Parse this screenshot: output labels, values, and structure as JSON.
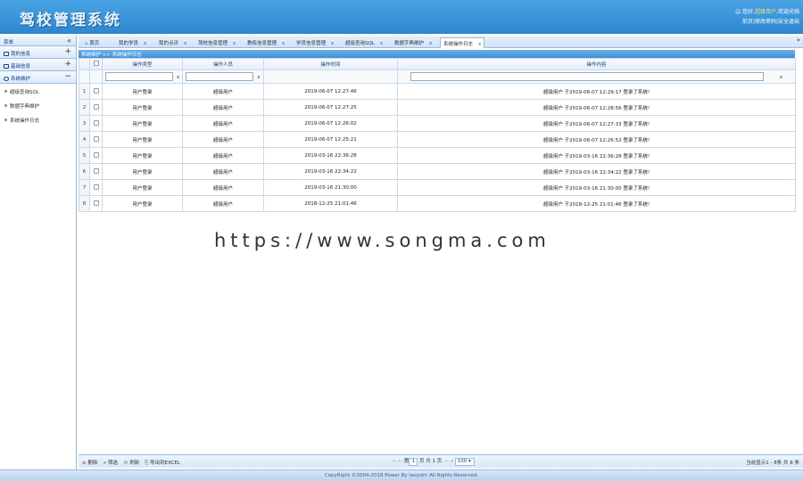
{
  "header": {
    "app_title": "驾校管理系统",
    "greeting": "您好,",
    "user_name": "超级用户",
    "welcome": ",欢迎光临",
    "links": "前页|修改密码|安全退出"
  },
  "sidebar": {
    "title": "菜单",
    "collapse_glyph": "«",
    "groups": [
      {
        "label": "我的信息",
        "toggle": "+"
      },
      {
        "label": "基础信息",
        "toggle": "+"
      },
      {
        "label": "系统维护",
        "toggle": "−"
      }
    ],
    "items": [
      {
        "label": "超级查询SQL"
      },
      {
        "label": "数据字典维护"
      },
      {
        "label": "系统操作日志"
      }
    ]
  },
  "tabs": [
    {
      "label": "首页",
      "closable": false
    },
    {
      "label": "我的学员",
      "closable": true
    },
    {
      "label": "我的点评",
      "closable": true
    },
    {
      "label": "驾校信息管理",
      "closable": true
    },
    {
      "label": "教练信息管理",
      "closable": true
    },
    {
      "label": "学员信息管理",
      "closable": true
    },
    {
      "label": "超级查询SQL",
      "closable": true
    },
    {
      "label": "数据字典维护",
      "closable": true
    },
    {
      "label": "系统操作日志",
      "closable": true,
      "active": true
    }
  ],
  "tabs_more": "»",
  "breadcrumb": "系统维护 >> 系统操作日志",
  "grid": {
    "columns": [
      "操作类型",
      "操作人员",
      "操作时间",
      "操作内容"
    ],
    "filter_clear": "x",
    "rows": [
      {
        "num": "1",
        "type": "用户登录",
        "operator": "超级用户",
        "time": "2019-06-07 12:27:46",
        "content": "超级用户 于2019-06-07 12:29:17 登录了系统!"
      },
      {
        "num": "2",
        "type": "用户登录",
        "operator": "超级用户",
        "time": "2019-06-07 12:27:25",
        "content": "超级用户 于2019-06-07 12:28:56 登录了系统!"
      },
      {
        "num": "3",
        "type": "用户登录",
        "operator": "超级用户",
        "time": "2019-06-07 12:26:02",
        "content": "超级用户 于2019-06-07 12:27:33 登录了系统!"
      },
      {
        "num": "4",
        "type": "用户登录",
        "operator": "超级用户",
        "time": "2019-06-07 12:25:21",
        "content": "超级用户 于2019-06-07 12:26:52 登录了系统!"
      },
      {
        "num": "5",
        "type": "用户登录",
        "operator": "超级用户",
        "time": "2019-03-16 22:36:28",
        "content": "超级用户 于2019-03-16 22:36:28 登录了系统!"
      },
      {
        "num": "6",
        "type": "用户登录",
        "operator": "超级用户",
        "time": "2019-03-16 22:34:22",
        "content": "超级用户 于2019-03-16 22:34:22 登录了系统!"
      },
      {
        "num": "7",
        "type": "用户登录",
        "operator": "超级用户",
        "time": "2019-03-16 21:30:00",
        "content": "超级用户 于2019-03-16 21:30:00 登录了系统!"
      },
      {
        "num": "8",
        "type": "用户登录",
        "operator": "超级用户",
        "time": "2018-12-25 21:01:46",
        "content": "超级用户 于2018-12-25 21:01:46 登录了系统!"
      }
    ]
  },
  "watermark": "https://www.songma.com",
  "toolbar": {
    "delete": "删除",
    "filter": "筛选",
    "refresh": "刷新",
    "export": "导出到EXCEL"
  },
  "pager": {
    "first": "⇤",
    "prev": "⇠",
    "page_label": "第",
    "page_value": "1",
    "page_total": "页 共 1 页",
    "next": "⇢",
    "last": "⇥",
    "page_size": "100",
    "info": "当前显示1 - 8条 共 8 条"
  },
  "footer": "CopyRight ©2004-2018 Power By taoydm All Rights Reserved.",
  "colors": {
    "header": "#2f86cf",
    "accent": "#99bbe8",
    "breadcrumb": "#3f8fd7"
  }
}
